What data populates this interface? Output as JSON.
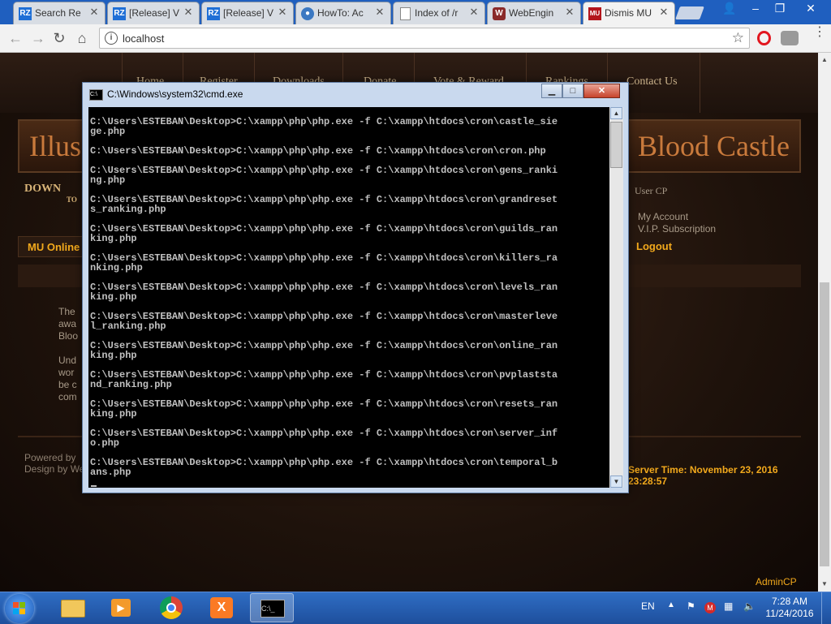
{
  "browser": {
    "tabs": [
      {
        "title": "Search Re",
        "icon": "rz-icon",
        "active": false
      },
      {
        "title": "[Release] V",
        "icon": "rz-icon",
        "active": false
      },
      {
        "title": "[Release] V",
        "icon": "rz-icon",
        "active": false
      },
      {
        "title": "HowTo: Ac",
        "icon": "globe-icon",
        "active": false
      },
      {
        "title": "Index of /r",
        "icon": "page-icon",
        "active": false
      },
      {
        "title": "WebEngin",
        "icon": "webengine-icon",
        "active": false
      },
      {
        "title": "Dismis MU",
        "icon": "mu-icon",
        "active": true
      }
    ],
    "address": "localhost",
    "colors": {
      "tabstrip": "#1f5fbf",
      "accent": "#f2a91c"
    }
  },
  "website": {
    "nav": [
      "Home",
      "Register",
      "Downloads",
      "Donate",
      "Vote & Reward",
      "Rankings",
      "Contact Us"
    ],
    "banner_left": "Illus",
    "banner_right": "Blood Castle",
    "download_title": "DOWN",
    "download_sub": "TO",
    "user_cp_title": "User CP",
    "user_cp_links": [
      "My Account",
      "V.I.P. Subscription"
    ],
    "logout": "Logout",
    "mu_online_label": "MU Online",
    "body_lines": [
      "The",
      "awa",
      "Bloo",
      "",
      "Und",
      "wor",
      "be c",
      "com"
    ],
    "powered_by": "Powered by",
    "design_by": "Design by We",
    "server_time": "Server Time: November 23, 2016 23:28:57",
    "admin_cp": "AdminCP"
  },
  "cmd_window": {
    "title": "C:\\Windows\\system32\\cmd.exe",
    "lines": [
      "C:\\Users\\ESTEBAN\\Desktop>C:\\xampp\\php\\php.exe -f C:\\xampp\\htdocs\\cron\\castle_sie",
      "ge.php",
      "",
      "C:\\Users\\ESTEBAN\\Desktop>C:\\xampp\\php\\php.exe -f C:\\xampp\\htdocs\\cron\\cron.php",
      "",
      "C:\\Users\\ESTEBAN\\Desktop>C:\\xampp\\php\\php.exe -f C:\\xampp\\htdocs\\cron\\gens_ranki",
      "ng.php",
      "",
      "C:\\Users\\ESTEBAN\\Desktop>C:\\xampp\\php\\php.exe -f C:\\xampp\\htdocs\\cron\\grandreset",
      "s_ranking.php",
      "",
      "C:\\Users\\ESTEBAN\\Desktop>C:\\xampp\\php\\php.exe -f C:\\xampp\\htdocs\\cron\\guilds_ran",
      "king.php",
      "",
      "C:\\Users\\ESTEBAN\\Desktop>C:\\xampp\\php\\php.exe -f C:\\xampp\\htdocs\\cron\\killers_ra",
      "nking.php",
      "",
      "C:\\Users\\ESTEBAN\\Desktop>C:\\xampp\\php\\php.exe -f C:\\xampp\\htdocs\\cron\\levels_ran",
      "king.php",
      "",
      "C:\\Users\\ESTEBAN\\Desktop>C:\\xampp\\php\\php.exe -f C:\\xampp\\htdocs\\cron\\masterleve",
      "l_ranking.php",
      "",
      "C:\\Users\\ESTEBAN\\Desktop>C:\\xampp\\php\\php.exe -f C:\\xampp\\htdocs\\cron\\online_ran",
      "king.php",
      "",
      "C:\\Users\\ESTEBAN\\Desktop>C:\\xampp\\php\\php.exe -f C:\\xampp\\htdocs\\cron\\pvplaststa",
      "nd_ranking.php",
      "",
      "C:\\Users\\ESTEBAN\\Desktop>C:\\xampp\\php\\php.exe -f C:\\xampp\\htdocs\\cron\\resets_ran",
      "king.php",
      "",
      "C:\\Users\\ESTEBAN\\Desktop>C:\\xampp\\php\\php.exe -f C:\\xampp\\htdocs\\cron\\server_inf",
      "o.php",
      "",
      "C:\\Users\\ESTEBAN\\Desktop>C:\\xampp\\php\\php.exe -f C:\\xampp\\htdocs\\cron\\temporal_b",
      "ans.php"
    ]
  },
  "taskbar": {
    "apps": [
      "explorer-icon",
      "media-player-icon",
      "chrome-icon",
      "xampp-icon",
      "cmd-icon"
    ],
    "active_app": "cmd-icon",
    "language": "EN",
    "time": "7:28 AM",
    "date": "11/24/2016"
  }
}
